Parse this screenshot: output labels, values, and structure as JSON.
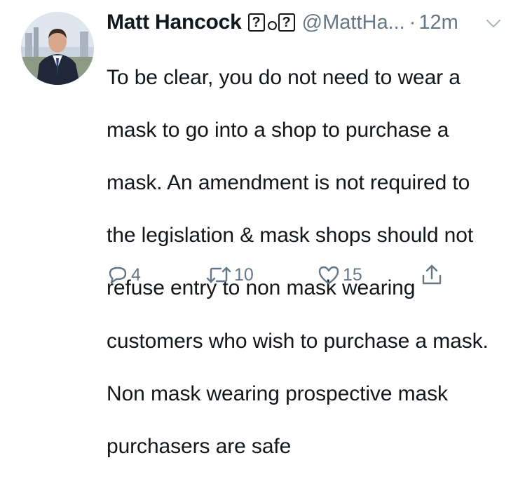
{
  "tweet": {
    "author_name": "Matt Hancock",
    "emoji_glyph": "?",
    "handle": "@MattHa...",
    "separator": "·",
    "time": "12m",
    "text_lines": [
      "To be clear, you do not need to wear a",
      "mask to go into a shop to purchase a",
      "mask. An amendment is not required to",
      "the legislation & mask shops should not",
      "refuse entry to non mask wearing",
      "customers who wish to purchase a mask.",
      "Non mask wearing prospective mask",
      "purchasers are safe"
    ]
  },
  "actions": {
    "reply_count": "4",
    "retweet_count": "10",
    "like_count": "15"
  },
  "icons": {
    "reply": "reply-icon",
    "retweet": "retweet-icon",
    "like": "heart-icon",
    "share": "share-icon",
    "more": "chevron-down-icon"
  },
  "colors": {
    "text": "#14171a",
    "muted": "#657786",
    "background": "#ffffff"
  }
}
